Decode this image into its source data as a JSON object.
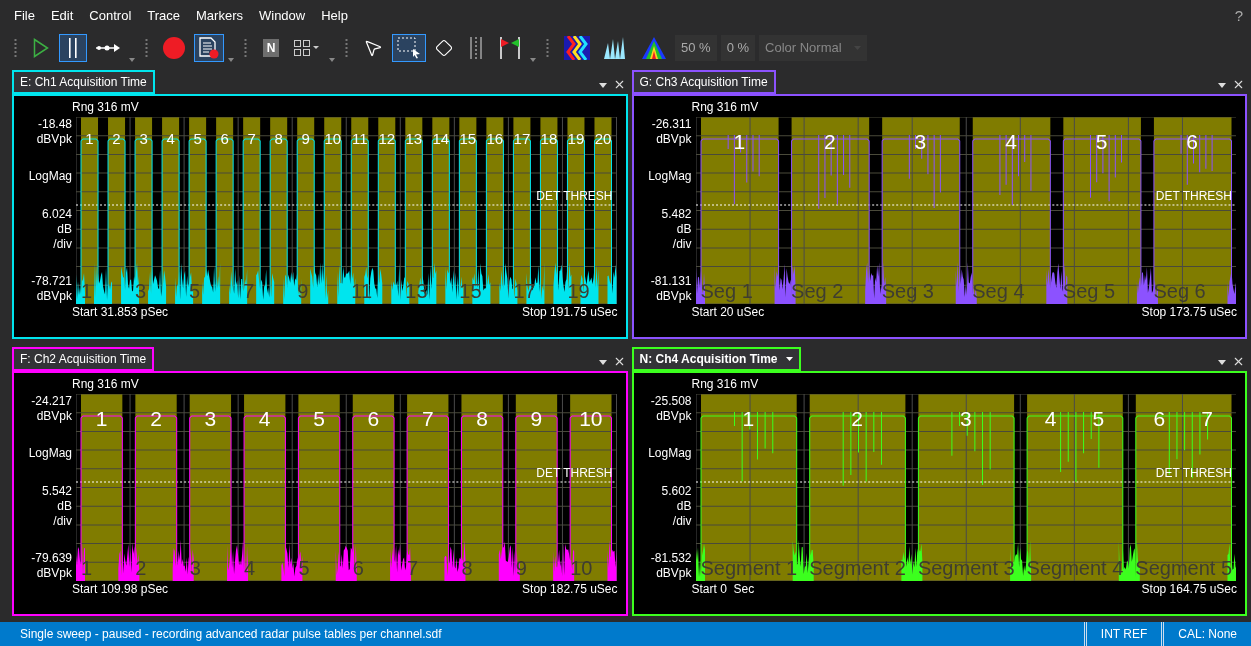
{
  "menu": [
    "File",
    "Edit",
    "Control",
    "Trace",
    "Markers",
    "Window",
    "Help"
  ],
  "help": "?",
  "toolbar": [
    {
      "kind": "grip"
    },
    {
      "kind": "play",
      "selected": false
    },
    {
      "kind": "pause",
      "selected": true
    },
    {
      "kind": "step",
      "selected": false,
      "dropdown": true
    },
    {
      "kind": "grip"
    },
    {
      "kind": "record",
      "selected": false
    },
    {
      "kind": "record_document",
      "selected": true,
      "dropdown": true
    },
    {
      "kind": "grip"
    },
    {
      "kind": "letter",
      "text": "N",
      "selected": false
    },
    {
      "kind": "layout",
      "selected": false,
      "dropdown": true
    },
    {
      "kind": "grip"
    },
    {
      "kind": "pointer",
      "selected": false
    },
    {
      "kind": "region_select",
      "selected": true
    },
    {
      "kind": "diamond",
      "selected": false
    },
    {
      "kind": "cursor_lines",
      "selected": false
    },
    {
      "kind": "flags",
      "selected": false,
      "dropdown": true
    },
    {
      "kind": "grip"
    },
    {
      "kind": "waterfall",
      "selected": false
    },
    {
      "kind": "spectrogram",
      "selected": false
    },
    {
      "kind": "density",
      "selected": false
    },
    {
      "kind": "readout",
      "text": "50 %"
    },
    {
      "kind": "readout",
      "text": "0 %"
    },
    {
      "kind": "combo",
      "text": "Color Normal",
      "disabled": true
    }
  ],
  "panels": [
    {
      "title": "E: Ch1 Acquisition Time",
      "selected": false,
      "menu": false,
      "color": "#00e5ee",
      "range": "Rng 316 mV",
      "top_value": "-18.48",
      "top_unit": "dBVpk",
      "format": "LogMag",
      "scale_value": "6.024",
      "scale_unit": "dB",
      "scale_per": "/div",
      "bottom_value": "-78.721",
      "bottom_unit": "dBVpk",
      "threshold": "DET THRESH",
      "start": "Start 31.853 pSec",
      "stop": "Stop 191.75 uSec",
      "segments": [
        {
          "pulses": [
            "1"
          ],
          "label": "1"
        },
        {
          "pulses": [
            "2"
          ]
        },
        {
          "pulses": [
            "3"
          ],
          "label": "3"
        },
        {
          "pulses": [
            "4"
          ]
        },
        {
          "pulses": [
            "5"
          ],
          "label": "5"
        },
        {
          "pulses": [
            "6"
          ]
        },
        {
          "pulses": [
            "7"
          ],
          "label": "7"
        },
        {
          "pulses": [
            "8"
          ]
        },
        {
          "pulses": [
            "9"
          ],
          "label": "9"
        },
        {
          "pulses": [
            "10"
          ]
        },
        {
          "pulses": [
            "11"
          ],
          "label": "11"
        },
        {
          "pulses": [
            "12"
          ]
        },
        {
          "pulses": [
            "13"
          ],
          "label": "13"
        },
        {
          "pulses": [
            "14"
          ]
        },
        {
          "pulses": [
            "15"
          ],
          "label": "15"
        },
        {
          "pulses": [
            "16"
          ]
        },
        {
          "pulses": [
            "17"
          ],
          "label": "17"
        },
        {
          "pulses": [
            "18"
          ]
        },
        {
          "pulses": [
            "19"
          ],
          "label": "19"
        },
        {
          "pulses": [
            "20"
          ]
        }
      ]
    },
    {
      "title": "G: Ch3 Acquisition Time",
      "selected": false,
      "menu": false,
      "color": "#8c52ff",
      "range": "Rng 316 mV",
      "top_value": "-26.311",
      "top_unit": "dBVpk",
      "format": "LogMag",
      "scale_value": "5.482",
      "scale_unit": "dB",
      "scale_per": "/div",
      "bottom_value": "-81.131",
      "bottom_unit": "dBVpk",
      "threshold": "DET THRESH",
      "start": "Start 20 uSec",
      "stop": "Stop 173.75 uSec",
      "segments": [
        {
          "pulses": [
            "1"
          ],
          "label": "Seg 1"
        },
        {
          "pulses": [
            "2"
          ],
          "label": "Seg 2"
        },
        {
          "pulses": [
            "3"
          ],
          "label": "Seg 3"
        },
        {
          "pulses": [
            "4"
          ],
          "label": "Seg 4"
        },
        {
          "pulses": [
            "5"
          ],
          "label": "Seg 5"
        },
        {
          "pulses": [
            "6"
          ],
          "label": "Seg 6"
        }
      ]
    },
    {
      "title": "F: Ch2 Acquisition Time",
      "selected": false,
      "menu": false,
      "color": "#ff00ff",
      "range": "Rng 316 mV",
      "top_value": "-24.217",
      "top_unit": "dBVpk",
      "format": "LogMag",
      "scale_value": "5.542",
      "scale_unit": "dB",
      "scale_per": "/div",
      "bottom_value": "-79.639",
      "bottom_unit": "dBVpk",
      "threshold": "DET THRESH",
      "start": "Start 109.98 pSec",
      "stop": "Stop 182.75 uSec",
      "segments": [
        {
          "pulses": [
            "1"
          ],
          "label": "1"
        },
        {
          "pulses": [
            "2"
          ],
          "label": "2"
        },
        {
          "pulses": [
            "3"
          ],
          "label": "3"
        },
        {
          "pulses": [
            "4"
          ],
          "label": "4"
        },
        {
          "pulses": [
            "5"
          ],
          "label": "5"
        },
        {
          "pulses": [
            "6"
          ],
          "label": "6"
        },
        {
          "pulses": [
            "7"
          ],
          "label": "7"
        },
        {
          "pulses": [
            "8"
          ],
          "label": "8"
        },
        {
          "pulses": [
            "9"
          ],
          "label": "9"
        },
        {
          "pulses": [
            "10"
          ],
          "label": "10"
        }
      ]
    },
    {
      "title": "N: Ch4 Acquisition Time",
      "selected": true,
      "menu": true,
      "color": "#3cff1e",
      "range": "Rng 316 mV",
      "top_value": "-25.508",
      "top_unit": "dBVpk",
      "format": "LogMag",
      "scale_value": "5.602",
      "scale_unit": "dB",
      "scale_per": "/div",
      "bottom_value": "-81.532",
      "bottom_unit": "dBVpk",
      "threshold": "DET THRESH",
      "start": "Start 0  Sec",
      "stop": "Stop 164.75 uSec",
      "segments": [
        {
          "pulses": [
            "1"
          ],
          "label": "Segment 1"
        },
        {
          "pulses": [
            "2"
          ],
          "label": "Segment 2"
        },
        {
          "pulses": [
            "3"
          ],
          "label": "Segment 3"
        },
        {
          "pulses": [
            "4",
            "5"
          ],
          "label": "Segment 4"
        },
        {
          "pulses": [
            "6",
            "7"
          ],
          "label": "Segment 5"
        }
      ]
    }
  ],
  "status_bar": {
    "message": "Single sweep - paused - recording advanced radar pulse tables per channel.sdf",
    "items": [
      "INT REF",
      "CAL: None"
    ]
  }
}
